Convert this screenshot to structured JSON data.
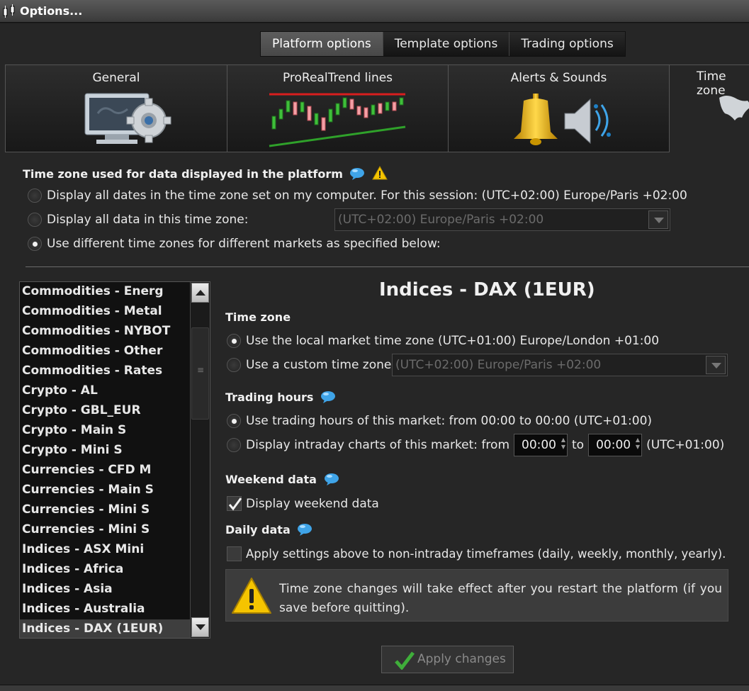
{
  "window": {
    "title": "Options..."
  },
  "top_tabs": [
    "Platform options",
    "Template options",
    "Trading options"
  ],
  "categories": [
    {
      "label": "General",
      "icon": "computer-gear-icon"
    },
    {
      "label": "ProRealTrend lines",
      "icon": "candlestick-trend-icon"
    },
    {
      "label": "Alerts & Sounds",
      "icon": "bell-speaker-icon"
    },
    {
      "label": "Time zone",
      "icon": "world-map-icon"
    }
  ],
  "timezone_section": {
    "title": "Time zone used for data displayed in the platform",
    "option_computer": "Display all dates in the time zone set on my computer. For this session:  (UTC+02:00) Europe/Paris +02:00",
    "option_this_zone": "Display all data in this time zone:",
    "option_this_zone_value": "(UTC+02:00) Europe/Paris +02:00",
    "option_different": "Use different time zones for different markets as specified below:"
  },
  "markets": {
    "items": [
      "Commodities - Energ",
      "Commodities - Metal",
      "Commodities - NYBOT",
      "Commodities - Other",
      "Commodities - Rates",
      "Crypto - AL",
      "Crypto - GBL_EUR",
      "Crypto - Main S",
      "Crypto - Mini S",
      "Currencies - CFD M",
      "Currencies - Main S",
      "Currencies - Mini S",
      "Currencies - Mini S",
      "Indices - ASX Mini",
      "Indices - Africa",
      "Indices - Asia",
      "Indices - Australia",
      "Indices - DAX (1EUR)"
    ],
    "selected": "Indices - DAX (1EUR)"
  },
  "market_settings": {
    "title": "Indices - DAX (1EUR)",
    "time_zone_heading": "Time zone",
    "local_zone": "Use the local market time zone (UTC+01:00) Europe/London +01:00",
    "custom_zone": "Use a custom time zone:",
    "custom_zone_value": "(UTC+02:00) Europe/Paris +02:00",
    "trading_hours_heading": "Trading hours",
    "use_trading_hours": "Use trading hours of this market: from 00:00 to 00:00 (UTC+01:00)",
    "intraday_prefix": "Display intraday charts of this market: from",
    "intraday_from": "00:00",
    "intraday_to_label": "to",
    "intraday_to": "00:00",
    "intraday_suffix": "(UTC+01:00)",
    "weekend_heading": "Weekend data",
    "weekend_label": "Display weekend data",
    "daily_heading": "Daily data",
    "daily_label": "Apply settings above to non-intraday timeframes (daily, weekly, monthly, yearly).",
    "notice": "Time zone changes will take effect after you restart the platform (if you save before quitting).",
    "apply_label": "Apply changes"
  },
  "colors": {
    "accent_green": "#3fae3a",
    "warning_yellow": "#f5c400",
    "info_blue": "#3fa4e8",
    "trend_red": "#d81e1e"
  }
}
